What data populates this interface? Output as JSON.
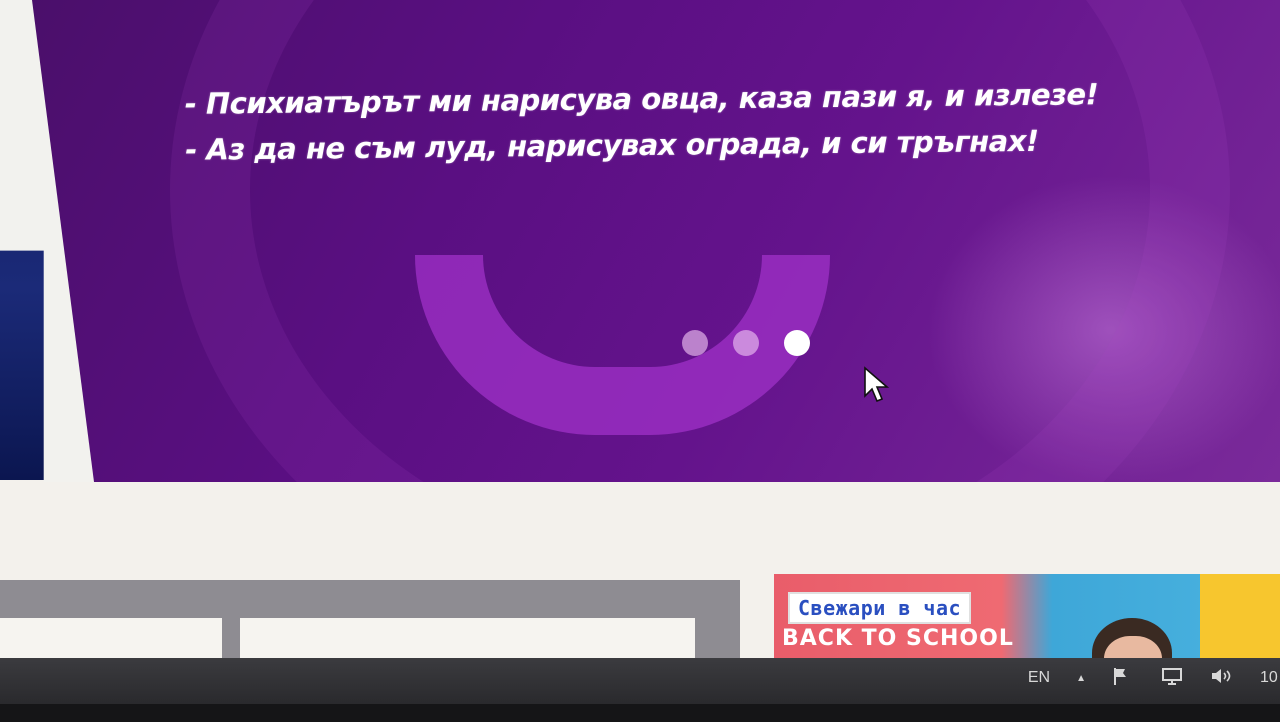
{
  "banner": {
    "joke_line_1": "- Психиатърът ми нарисува овца, каза пази я, и излезе!",
    "joke_line_2": "- Аз да не съм луд, нарисувах ограда, и си тръгнах!",
    "slides": {
      "count": 3,
      "active_index": 3
    }
  },
  "promo": {
    "title": "Свежари в час",
    "subtitle": "BACK TO SCHOOL"
  },
  "taskbar": {
    "language": "EN",
    "tray_up": "▲",
    "clock_fragment": "10"
  },
  "colors": {
    "banner_purple": "#5a0f82",
    "accent_pink": "#e95d6a",
    "accent_blue": "#3ea7d8"
  }
}
